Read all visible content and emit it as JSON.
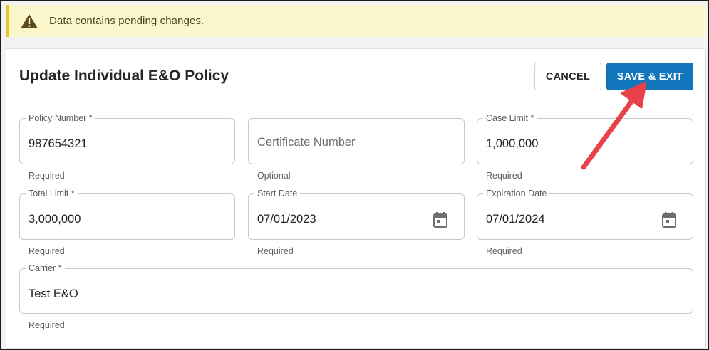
{
  "banner": {
    "message": "Data contains pending changes.",
    "icon": "warning-triangle-icon"
  },
  "form": {
    "title": "Update Individual E&O Policy",
    "cancel_label": "CANCEL",
    "save_label": "SAVE & EXIT",
    "fields": [
      {
        "label": "Policy Number *",
        "value": "987654321",
        "placeholder": "",
        "helper": "Required"
      },
      {
        "label": "",
        "value": "",
        "placeholder": "Certificate Number",
        "helper": "Optional"
      },
      {
        "label": "Case Limit *",
        "value": "1,000,000",
        "placeholder": "",
        "helper": "Required"
      },
      {
        "label": "Total Limit *",
        "value": "3,000,000",
        "placeholder": "",
        "helper": "Required"
      },
      {
        "label": "Start Date",
        "value": "07/01/2023",
        "placeholder": "",
        "helper": "Required",
        "icon": "calendar-icon"
      },
      {
        "label": "Expiration Date",
        "value": "07/01/2024",
        "placeholder": "",
        "helper": "Required",
        "icon": "calendar-icon"
      },
      {
        "label": "Carrier *",
        "value": "Test E&O",
        "placeholder": "",
        "helper": "Required"
      }
    ]
  },
  "colors": {
    "primary_button": "#1176bc",
    "banner_background": "#fbf6cc",
    "banner_accent": "#e9c52b",
    "annotation_arrow": "#e8414a"
  }
}
